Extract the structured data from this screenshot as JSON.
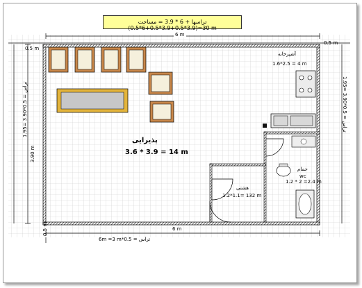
{
  "title": {
    "formula": "(0.5*6+0.5*3.9+0.5*3.9)=30 m",
    "label": "تراسها + 6 * 3.9 = مساحت"
  },
  "dimensions": {
    "top_width": "6 m",
    "bottom_width": "6 m",
    "top_offset_left": "0.5 m",
    "top_offset_right": "0.5 m",
    "bottom_offset": "0.5 m",
    "left_height": "3.90 m",
    "left_terrace": "تراس = 0.5*3.90 =1.95",
    "right_terrace": "تراس = 0.5*3.90 =1.95",
    "bottom_terrace": "تراس = 0.5*6m =3 m"
  },
  "rooms": {
    "reception": {
      "name": "پذیرایی",
      "area": "3.6 * 3.9 = 14 m"
    },
    "kitchen": {
      "name": "آشپزخانه",
      "area": "1.6*2.5 = 4 m"
    },
    "bathroom": {
      "name": "حمام",
      "name2": "wc",
      "area": "1.2 * 2 =2.4 m"
    },
    "entrance": {
      "name": "هشتی",
      "area": "1.2*1.1= 132 m"
    }
  }
}
